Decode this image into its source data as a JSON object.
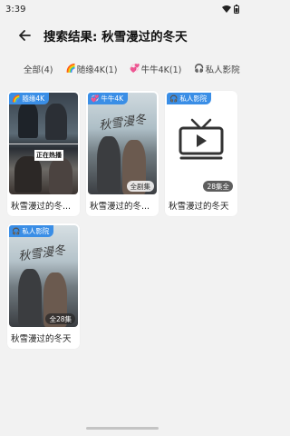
{
  "status_bar": {
    "time": "3:39"
  },
  "header": {
    "title": "搜索结果: 秋雪漫过的冬天"
  },
  "tabs": [
    {
      "label": "全部(4)",
      "icon": ""
    },
    {
      "label": "随缘4K(1)",
      "icon": "rainbow-icon"
    },
    {
      "label": "牛牛4K(1)",
      "icon": "hearts-icon"
    },
    {
      "label": "私人影院",
      "icon": "headphones-icon"
    }
  ],
  "results": [
    {
      "title": "秋雪漫过的冬...",
      "source": "随缘4K",
      "count": "",
      "poster_tag": "正在热播"
    },
    {
      "title": "秋雪漫过的冬...",
      "source": "牛牛4K",
      "count": "全剧集"
    },
    {
      "title": "秋雪漫过的冬天",
      "source": "私人影院",
      "count": "28集全"
    },
    {
      "title": "秋雪漫过的冬天",
      "source": "私人影院",
      "count": "全28集"
    }
  ],
  "colors": {
    "badge": "#3a8ee6",
    "background": "#f2f2f2"
  }
}
